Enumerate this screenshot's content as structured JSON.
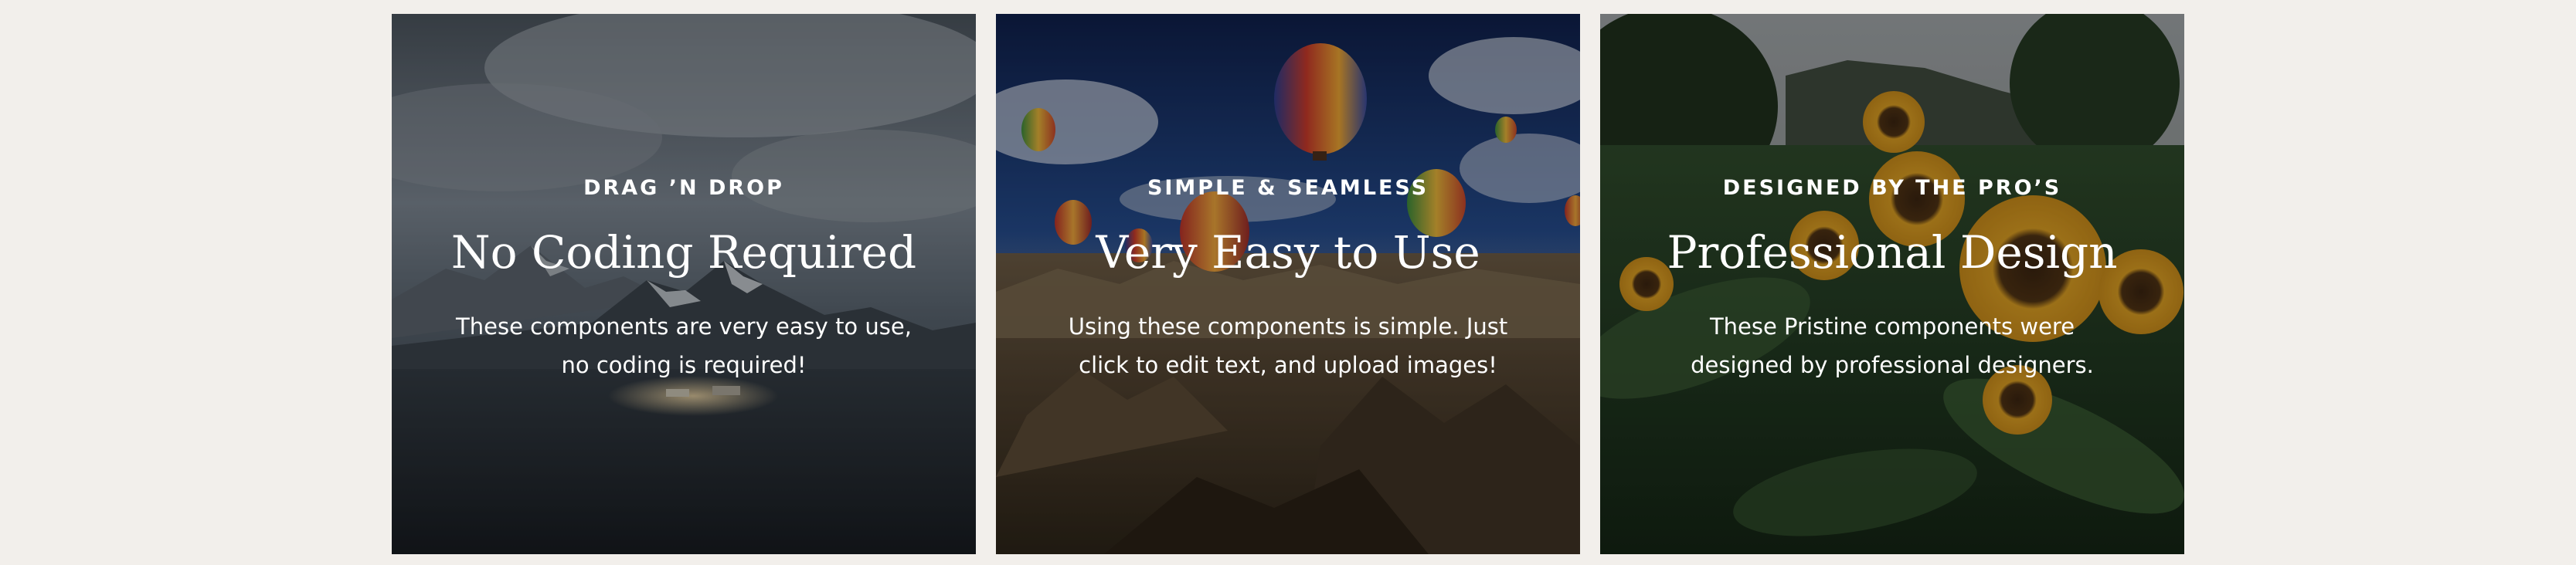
{
  "page": {
    "background_color": "#f2efeb"
  },
  "cards": [
    {
      "eyebrow": "DRAG ’N DROP",
      "title": "No Coding Required",
      "description": "These components are very easy to use, no coding is required!",
      "image": "mountain-landscape"
    },
    {
      "eyebrow": "SIMPLE & SEAMLESS",
      "title": "Very Easy to Use",
      "description": "Using these components is simple. Just click to edit text, and upload images!",
      "image": "hot-air-balloons"
    },
    {
      "eyebrow": "DESIGNED BY THE PRO’S",
      "title": "Professional Design",
      "description": "These Pristine components were designed by professional designers.",
      "image": "sunflower-field"
    }
  ]
}
